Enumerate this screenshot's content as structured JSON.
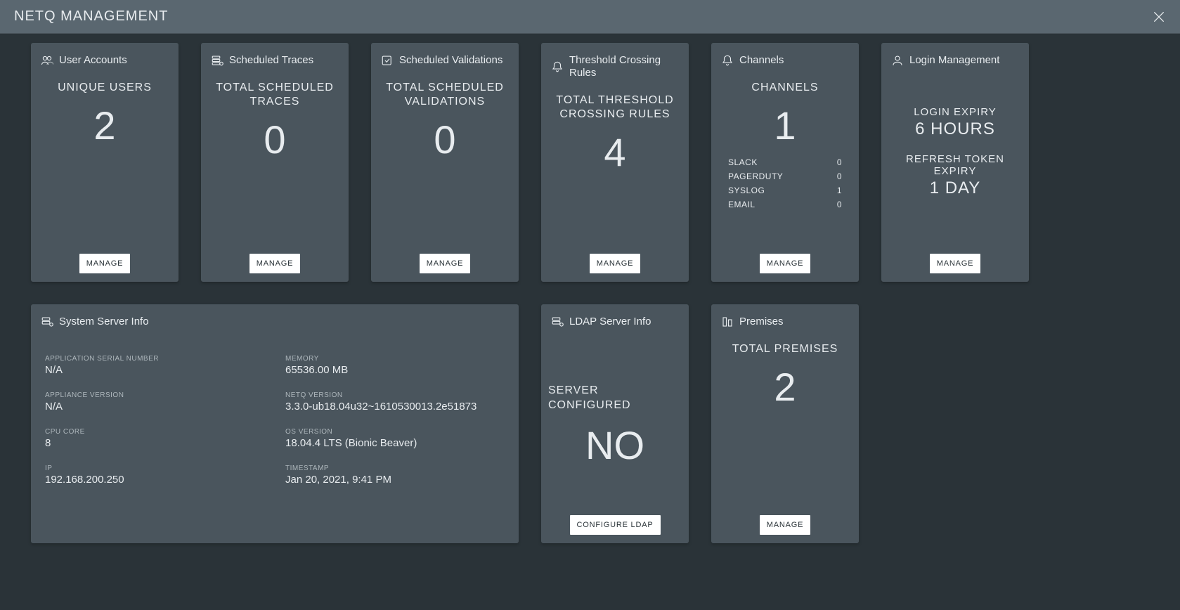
{
  "header": {
    "title": "NETQ MANAGEMENT"
  },
  "buttons": {
    "manage": "MANAGE",
    "configure_ldap": "CONFIGURE LDAP"
  },
  "cards": {
    "user_accounts": {
      "title": "User Accounts",
      "stat_label": "UNIQUE USERS",
      "stat_value": "2"
    },
    "scheduled_traces": {
      "title": "Scheduled Traces",
      "stat_label": "TOTAL SCHEDULED TRACES",
      "stat_value": "0"
    },
    "scheduled_validations": {
      "title": "Scheduled Validations",
      "stat_label": "TOTAL SCHEDULED VALIDATIONS",
      "stat_value": "0"
    },
    "threshold": {
      "title": "Threshold Crossing Rules",
      "stat_label": "TOTAL THRESHOLD CROSSING RULES",
      "stat_value": "4"
    },
    "channels": {
      "title": "Channels",
      "stat_label": "CHANNELS",
      "stat_value": "1",
      "items": [
        {
          "name": "SLACK",
          "value": "0"
        },
        {
          "name": "PAGERDUTY",
          "value": "0"
        },
        {
          "name": "SYSLOG",
          "value": "1"
        },
        {
          "name": "EMAIL",
          "value": "0"
        }
      ]
    },
    "login": {
      "title": "Login Management",
      "expiry_label": "LOGIN EXPIRY",
      "expiry_value": "6 HOURS",
      "refresh_label": "REFRESH TOKEN EXPIRY",
      "refresh_value": "1 DAY"
    },
    "server_info": {
      "title": "System Server Info",
      "items": [
        {
          "label": "APPLICATION SERIAL NUMBER",
          "value": "N/A"
        },
        {
          "label": "MEMORY",
          "value": "65536.00 MB"
        },
        {
          "label": "APPLIANCE VERSION",
          "value": "N/A"
        },
        {
          "label": "NETQ VERSION",
          "value": "3.3.0-ub18.04u32~1610530013.2e51873"
        },
        {
          "label": "CPU CORE",
          "value": "8"
        },
        {
          "label": "OS VERSION",
          "value": "18.04.4 LTS (Bionic Beaver)"
        },
        {
          "label": "IP",
          "value": "192.168.200.250"
        },
        {
          "label": "TIMESTAMP",
          "value": "Jan 20, 2021, 9:41 PM"
        }
      ]
    },
    "ldap": {
      "title": "LDAP Server Info",
      "stat_label": "SERVER CONFIGURED",
      "stat_value": "NO"
    },
    "premises": {
      "title": "Premises",
      "stat_label": "TOTAL PREMISES",
      "stat_value": "2"
    }
  }
}
